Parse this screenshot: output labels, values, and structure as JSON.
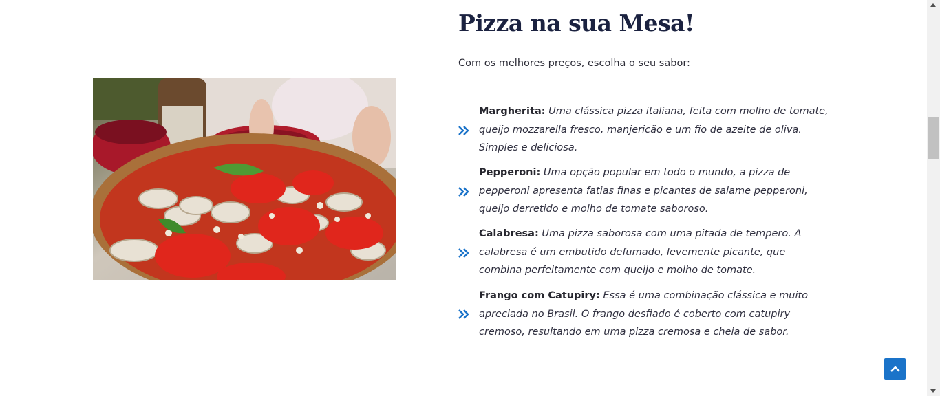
{
  "section": {
    "title": "Pizza na sua Mesa!",
    "subtitle": "Com os melhores preços, escolha o seu sabor:",
    "accent_color": "#1a73c9"
  },
  "menu": {
    "items": [
      {
        "name": "Margherita:",
        "description": "Uma clássica pizza italiana, feita com molho de tomate, queijo mozzarella fresco, manjericão e um fio de azeite de oliva. Simples e deliciosa.",
        "icon": "double-chevron-right-icon"
      },
      {
        "name": "Pepperoni:",
        "description": "Uma opção popular em todo o mundo, a pizza de pepperoni apresenta fatias finas e picantes de salame pepperoni, queijo derretido e molho de tomate saboroso.",
        "icon": "double-chevron-right-icon"
      },
      {
        "name": "Calabresa:",
        "description": "Uma pizza saborosa com uma pitada de tempero. A calabresa é um embutido defumado, levemente picante, que combina perfeitamente com queijo e molho de tomate.",
        "icon": "double-chevron-right-icon"
      },
      {
        "name": "Frango com Catupiry:",
        "description": "Essa é uma combinação clássica e muito apreciada no Brasil. O frango desfiado é coberto com catupiry cremoso, resultando em uma pizza cremosa e cheia de sabor.",
        "icon": "double-chevron-right-icon"
      }
    ]
  },
  "scroll_top": {
    "icon": "chevron-up-icon"
  }
}
